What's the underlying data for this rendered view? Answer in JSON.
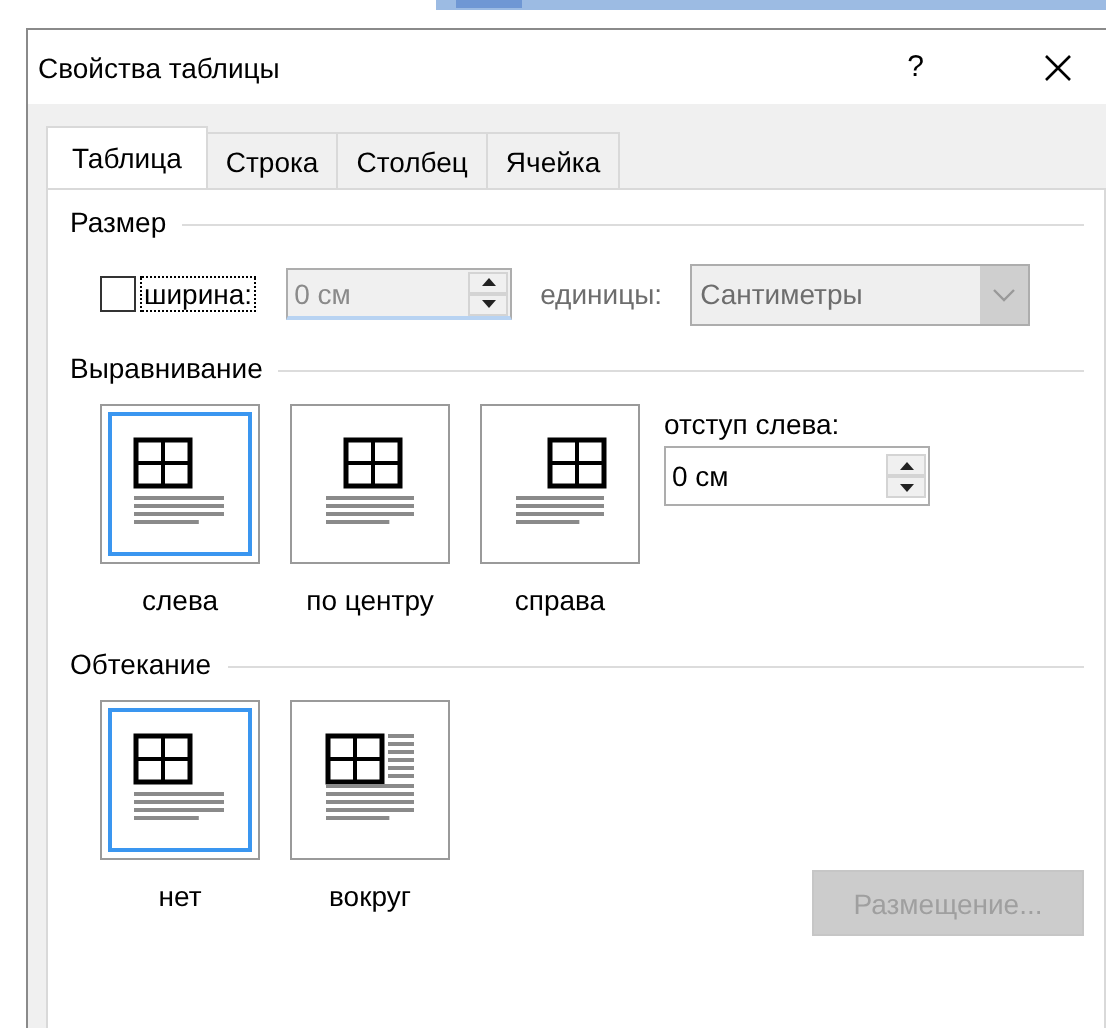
{
  "dialog": {
    "title": "Свойства таблицы",
    "help": "?"
  },
  "tabs": [
    {
      "label": "Таблица",
      "selected": true
    },
    {
      "label": "Строка",
      "selected": false
    },
    {
      "label": "Столбец",
      "selected": false
    },
    {
      "label": "Ячейка",
      "selected": false
    }
  ],
  "size": {
    "heading": "Размер",
    "width_checkbox": {
      "label": "ширина:",
      "checked": false
    },
    "width_field": {
      "value": "0 см",
      "disabled": true
    },
    "units_label": "единицы:",
    "units_combo": {
      "value": "Сантиметры",
      "disabled": true
    }
  },
  "alignment": {
    "heading": "Выравнивание",
    "options": [
      {
        "label": "слева",
        "kind": "left",
        "selected": true
      },
      {
        "label": "по центру",
        "kind": "center",
        "selected": false
      },
      {
        "label": "справа",
        "kind": "right",
        "selected": false
      }
    ],
    "indent_label": "отступ слева:",
    "indent_field": {
      "value": "0 см"
    }
  },
  "wrapping": {
    "heading": "Обтекание",
    "options": [
      {
        "label": "нет",
        "kind": "none",
        "selected": true
      },
      {
        "label": "вокруг",
        "kind": "around",
        "selected": false
      }
    ],
    "positioning_button": {
      "label": "Размещение...",
      "disabled": true
    }
  }
}
